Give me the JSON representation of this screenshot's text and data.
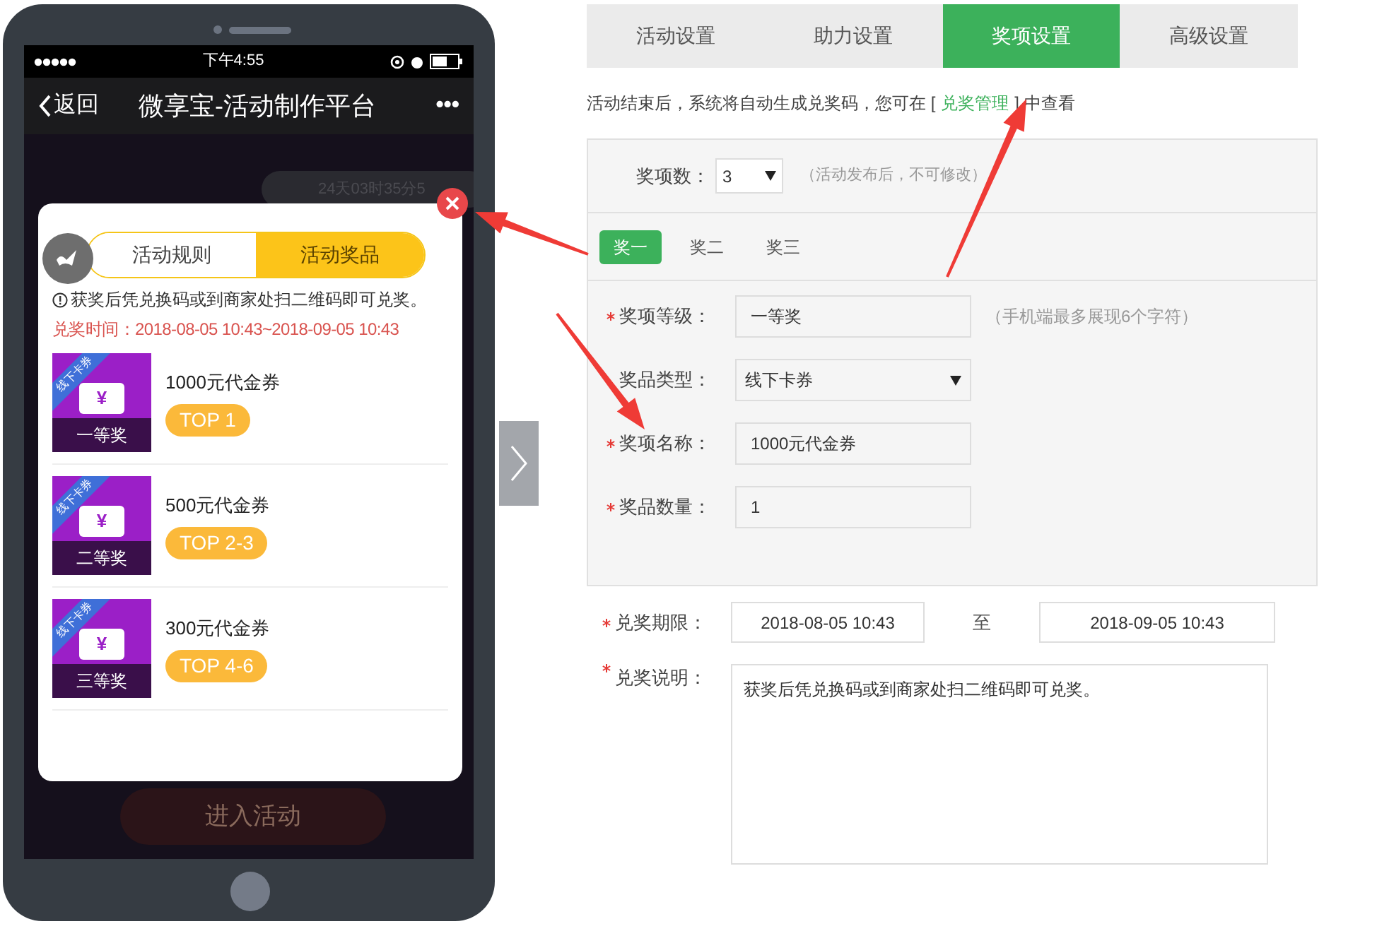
{
  "phone": {
    "status_bar": {
      "time": "下午4:55"
    },
    "nav": {
      "back": "返回",
      "title": "微享宝-活动制作平台",
      "more": "•••"
    },
    "countdown": "24天03时35分5",
    "enter_button": "进入活动",
    "popup": {
      "tabs": [
        {
          "label": "活动规则",
          "selected": false
        },
        {
          "label": "活动奖品",
          "selected": true
        }
      ],
      "notice": "获奖后凭兑换码或到商家处扫二维码即可兑奖。",
      "redeem_time": "兑奖时间：2018-08-05 10:43~2018-09-05 10:43",
      "prizes": [
        {
          "ribbon": "线下卡券",
          "symbol": "¥",
          "level": "一等奖",
          "name": "1000元代金券",
          "rank": "TOP 1"
        },
        {
          "ribbon": "线下卡券",
          "symbol": "¥",
          "level": "二等奖",
          "name": "500元代金券",
          "rank": "TOP 2-3"
        },
        {
          "ribbon": "线下卡券",
          "symbol": "¥",
          "level": "三等奖",
          "name": "300元代金券",
          "rank": "TOP 4-6"
        }
      ]
    }
  },
  "settings": {
    "tabs": [
      {
        "label": "活动设置",
        "selected": false
      },
      {
        "label": "助力设置",
        "selected": false
      },
      {
        "label": "奖项设置",
        "selected": true
      },
      {
        "label": "高级设置",
        "selected": false
      }
    ],
    "info": {
      "before": "活动结束后，系统将自动生成兑奖码，您可在 [",
      "link": "兑奖管理",
      "after": "] 中查看"
    },
    "prize_count": {
      "label": "奖项数：",
      "value": "3",
      "hint": "（活动发布后，不可修改）"
    },
    "prize_tabs": [
      {
        "label": "奖一",
        "selected": true
      },
      {
        "label": "奖二",
        "selected": false
      },
      {
        "label": "奖三",
        "selected": false
      }
    ],
    "fields": [
      {
        "kind": "input",
        "required": true,
        "label": "奖项等级：",
        "value": "一等奖",
        "hint": "（手机端最多展现6个字符）"
      },
      {
        "kind": "select",
        "required": false,
        "label": "奖品类型：",
        "value": "线下卡券"
      },
      {
        "kind": "input",
        "required": true,
        "label": "奖项名称：",
        "value": "1000元代金券"
      },
      {
        "kind": "input",
        "required": true,
        "label": "奖品数量：",
        "value": "1"
      }
    ],
    "period": {
      "required": true,
      "label": "兑奖期限：",
      "start": "2018-08-05 10:43",
      "to": "至",
      "end": "2018-09-05 10:43"
    },
    "description": {
      "required": true,
      "label": "兑奖说明：",
      "value": "获奖后凭兑换码或到商家处扫二维码即可兑奖。"
    }
  }
}
